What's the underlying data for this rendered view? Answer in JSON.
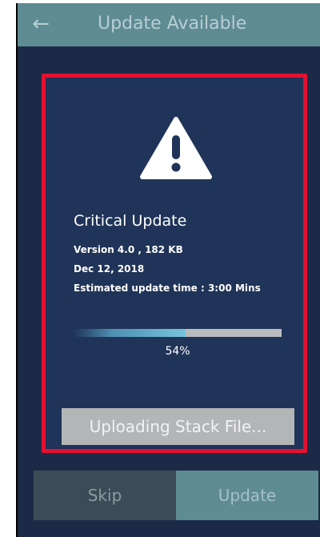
{
  "header": {
    "back_icon": "←",
    "title": "Update Available"
  },
  "update": {
    "icon": "warning-triangle-icon",
    "title": "Critical Update",
    "version_line": "Version 4.0 , 182 KB",
    "date_line": "Dec 12, 2018",
    "estimate_line": "Estimated update time : 3:00 Mins",
    "progress_percent": 54,
    "progress_label": "54%",
    "status_button": "Uploading Stack File..."
  },
  "actions": {
    "skip_label": "Skip",
    "update_label": "Update"
  },
  "colors": {
    "header_bg": "#5f8b93",
    "screen_bg": "#1d2a47",
    "panel_bg": "#203358",
    "highlight_border": "#e3112f",
    "progress_fill": "#77c3dc"
  }
}
